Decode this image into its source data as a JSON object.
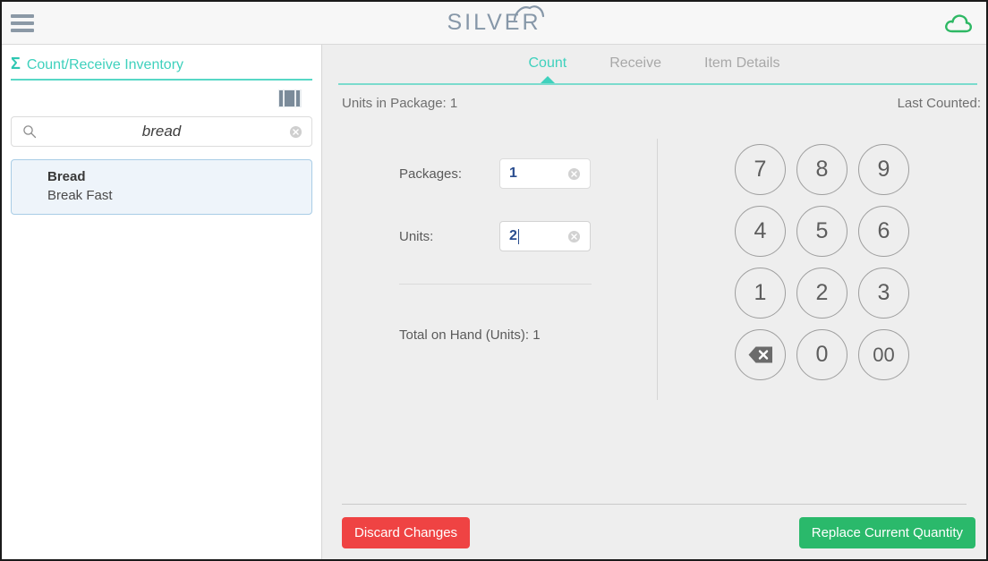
{
  "header": {
    "menu_icon": "hamburger-menu-icon",
    "brand": "SILVER",
    "cloud_icon": "cloud-icon"
  },
  "sidebar": {
    "title": "Count/Receive Inventory",
    "sigma": "Σ",
    "barcode_icon": "barcode-icon",
    "search": {
      "value": "bread",
      "placeholder": "",
      "search_icon": "search-icon",
      "clear_icon": "clear-circle-icon"
    },
    "results": [
      {
        "name": "Bread",
        "subtitle": "Break Fast"
      }
    ]
  },
  "main": {
    "tabs": [
      {
        "label": "Count",
        "active": true
      },
      {
        "label": "Receive",
        "active": false
      },
      {
        "label": "Item Details",
        "active": false
      }
    ],
    "meta": {
      "units_in_package": "Units in Package: 1",
      "last_counted": "Last Counted:"
    },
    "form": {
      "packages_label": "Packages:",
      "packages_value": "1",
      "units_label": "Units:",
      "units_value": "2",
      "total_on_hand": "Total on Hand (Units): 1",
      "clear_icon": "clear-circle-icon"
    },
    "keypad": {
      "keys": [
        "7",
        "8",
        "9",
        "4",
        "5",
        "6",
        "1",
        "2",
        "3",
        "backspace",
        "0",
        "00"
      ],
      "backspace_icon": "backspace-icon"
    },
    "footer": {
      "discard_label": "Discard Changes",
      "replace_label": "Replace Current Quantity"
    }
  },
  "colors": {
    "teal": "#3fd1bd",
    "danger": "#ef4343",
    "success": "#2ab96b",
    "value_blue": "#2a4d8f",
    "brand_gray": "#8697a8"
  }
}
